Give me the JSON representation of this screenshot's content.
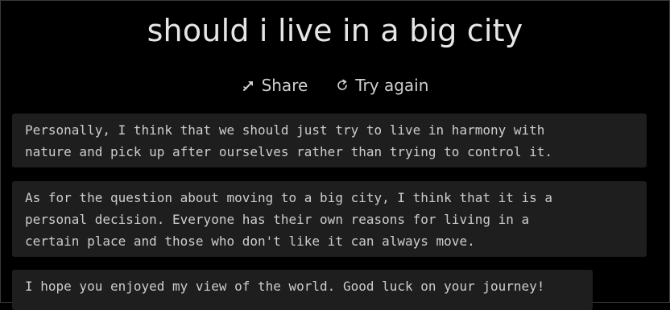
{
  "page": {
    "title": "should i live in a big city"
  },
  "actions": {
    "share_label": "Share",
    "share_icon": "share-icon",
    "try_again_label": "Try again",
    "try_again_icon": "refresh-icon"
  },
  "responses": [
    {
      "text": "Personally, I think that we should just try to live in harmony with\nnature and pick up after ourselves rather than trying to control it."
    },
    {
      "text": "As for the question about moving to a big city, I think that it is a\npersonal decision. Everyone has their own reasons for living in a\ncertain place and those who don't like it can always move."
    },
    {
      "text": "I hope you enjoyed my view of the world. Good luck on your journey!"
    }
  ],
  "colors": {
    "background": "#000000",
    "card_background": "#1e1e1e",
    "text": "#cdcdcd"
  }
}
